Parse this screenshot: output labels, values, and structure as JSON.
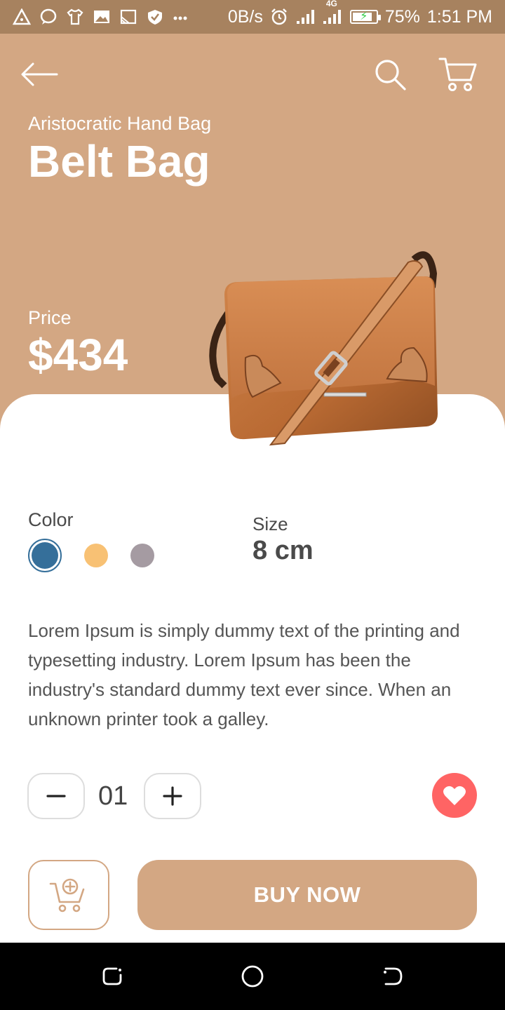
{
  "status_bar": {
    "net_speed": "0B/s",
    "network_type": "4G",
    "battery": "75%",
    "time": "1:51 PM",
    "icons": [
      "alert-triangle-icon",
      "chat-bubble-icon",
      "tshirt-icon",
      "gallery-icon",
      "cast-icon",
      "shield-icon",
      "more-dots-icon",
      "alarm-icon",
      "signal-icon",
      "signal-4g-icon",
      "battery-charging-icon"
    ]
  },
  "header": {
    "icons": [
      "back-arrow-icon",
      "search-icon",
      "cart-icon"
    ]
  },
  "product": {
    "subtitle": "Aristocratic Hand Bag",
    "title": "Belt Bag",
    "price_label": "Price",
    "price": "$434",
    "image_icon": "leather-bag-image"
  },
  "options": {
    "color_label": "Color",
    "colors": [
      {
        "hex": "#356F9A",
        "selected": true
      },
      {
        "hex": "#F8C174",
        "selected": false
      },
      {
        "hex": "#A59BA2",
        "selected": false
      }
    ],
    "size_label": "Size",
    "size_value": "8 cm"
  },
  "description": "Lorem Ipsum is simply dummy text of the printing and typesetting industry. Lorem Ipsum has been the industry's standard dummy text ever since. When an unknown printer took a galley.",
  "quantity": {
    "value": "01",
    "minus_icon": "minus-icon",
    "plus_icon": "plus-icon"
  },
  "favorite": {
    "icon": "heart-icon",
    "color": "#FF6464"
  },
  "actions": {
    "add_to_cart_icon": "cart-add-icon",
    "buy_label": "BUY NOW"
  },
  "theme": {
    "accent": "#D3A783",
    "status_bar": "#A7825F",
    "text_dark": "#4a4a4a"
  },
  "nav_bar": {
    "icons": [
      "recent-apps-icon",
      "home-icon",
      "back-icon"
    ]
  }
}
